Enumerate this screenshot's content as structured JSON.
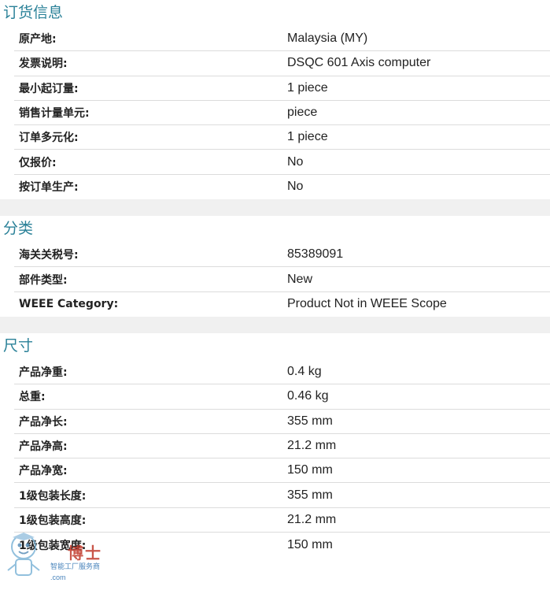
{
  "sections": [
    {
      "title": "订货信息",
      "rows": [
        {
          "label": "原产地:",
          "value": "Malaysia (MY)"
        },
        {
          "label": "发票说明:",
          "value": "DSQC 601 Axis computer"
        },
        {
          "label": "最小起订量:",
          "value": "1 piece"
        },
        {
          "label": "销售计量单元:",
          "value": "piece"
        },
        {
          "label": "订单多元化:",
          "value": "1 piece"
        },
        {
          "label": "仅报价:",
          "value": "No"
        },
        {
          "label": "按订单生产:",
          "value": "No"
        }
      ]
    },
    {
      "title": "分类",
      "rows": [
        {
          "label": "海关关税号:",
          "value": "85389091"
        },
        {
          "label": "部件类型:",
          "value": "New"
        },
        {
          "label": "WEEE Category:",
          "value": "Product Not in WEEE Scope"
        }
      ]
    },
    {
      "title": "尺寸",
      "rows": [
        {
          "label": "产品净重:",
          "value": "0.4 kg"
        },
        {
          "label": "总重:",
          "value": "0.46 kg"
        },
        {
          "label": "产品净长:",
          "value": "355 mm"
        },
        {
          "label": "产品净高:",
          "value": "21.2 mm"
        },
        {
          "label": "产品净宽:",
          "value": "150 mm"
        },
        {
          "label": "1级包装长度:",
          "value": "355 mm"
        },
        {
          "label": "1级包装高度:",
          "value": "21.2 mm"
        },
        {
          "label": "1级包装宽度:",
          "value": "150 mm"
        }
      ]
    }
  ],
  "watermark": {
    "brand": "博士",
    "tagline": "智能工厂服务商",
    "domain": ".com"
  },
  "colors": {
    "section_title": "#2a8198",
    "divider": "#dcdcdc",
    "gap": "#f0f0f0"
  }
}
